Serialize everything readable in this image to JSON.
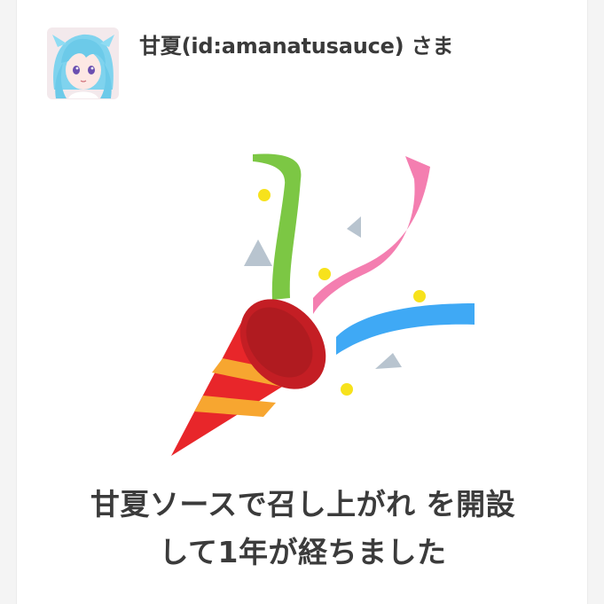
{
  "user": {
    "display_name": "甘夏(id:amanatusauce) さま"
  },
  "announcement": {
    "line1": "甘夏ソースで召し上がれ を開設",
    "line2": "して1年が経ちました"
  },
  "icons": {
    "avatar": "anime-avatar-icon",
    "celebration": "party-popper-icon"
  },
  "colors": {
    "text": "#3b3b3b",
    "popper_red": "#e8262a",
    "popper_orange": "#f7a630",
    "ribbon_green": "#7cc744",
    "ribbon_pink": "#f47eb0",
    "ribbon_blue": "#3fa9f5",
    "confetti_yellow": "#f7e21c",
    "confetti_gray": "#b8c4cf"
  }
}
